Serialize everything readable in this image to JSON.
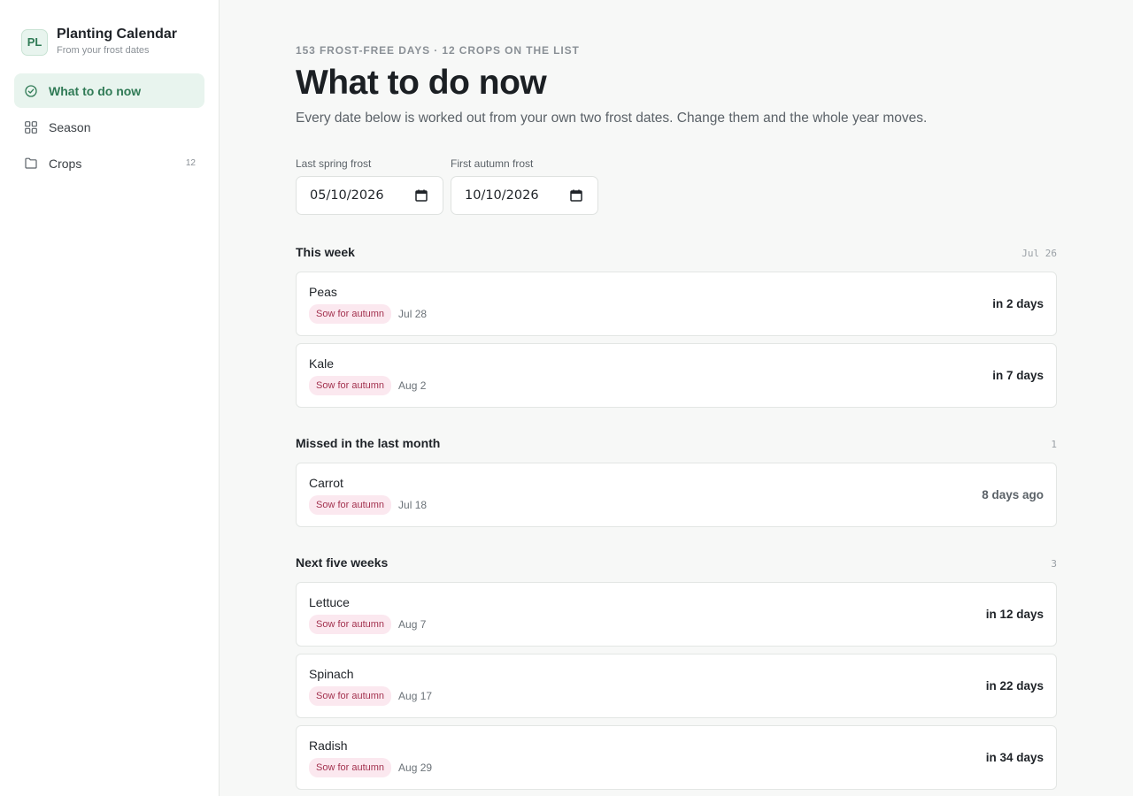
{
  "brand": {
    "initials": "PL",
    "title": "Planting Calendar",
    "subtitle": "From your frost dates"
  },
  "nav": [
    {
      "label": "What to do now",
      "icon": "check-circle-icon",
      "active": true
    },
    {
      "label": "Season",
      "icon": "grid-icon"
    },
    {
      "label": "Crops",
      "icon": "folder-icon",
      "count": "12"
    }
  ],
  "header": {
    "eyebrow": "153 frost-free days · 12 crops on the list",
    "title": "What to do now",
    "subtitle": "Every date below is worked out from your own two frost dates. Change them and the whole year moves."
  },
  "frost": {
    "spring_label": "Last spring frost",
    "spring_value": "05/10/2026",
    "autumn_label": "First autumn frost",
    "autumn_value": "10/10/2026"
  },
  "sections": [
    {
      "title": "This week",
      "meta": "Jul 26",
      "items": [
        {
          "name": "Peas",
          "badge": "Sow for autumn",
          "date": "Jul 28",
          "relative": "in 2 days"
        },
        {
          "name": "Kale",
          "badge": "Sow for autumn",
          "date": "Aug 2",
          "relative": "in 7 days"
        }
      ]
    },
    {
      "title": "Missed in the last month",
      "meta": "1",
      "items": [
        {
          "name": "Carrot",
          "badge": "Sow for autumn",
          "date": "Jul 18",
          "relative": "8 days ago",
          "past": true
        }
      ]
    },
    {
      "title": "Next five weeks",
      "meta": "3",
      "items": [
        {
          "name": "Lettuce",
          "badge": "Sow for autumn",
          "date": "Aug 7",
          "relative": "in 12 days"
        },
        {
          "name": "Spinach",
          "badge": "Sow for autumn",
          "date": "Aug 17",
          "relative": "in 22 days"
        },
        {
          "name": "Radish",
          "badge": "Sow for autumn",
          "date": "Aug 29",
          "relative": "in 34 days"
        }
      ]
    }
  ],
  "colors": {
    "accent": "#2f7a55",
    "badge_bg": "#fbe8ef",
    "badge_text": "#a3324f"
  }
}
